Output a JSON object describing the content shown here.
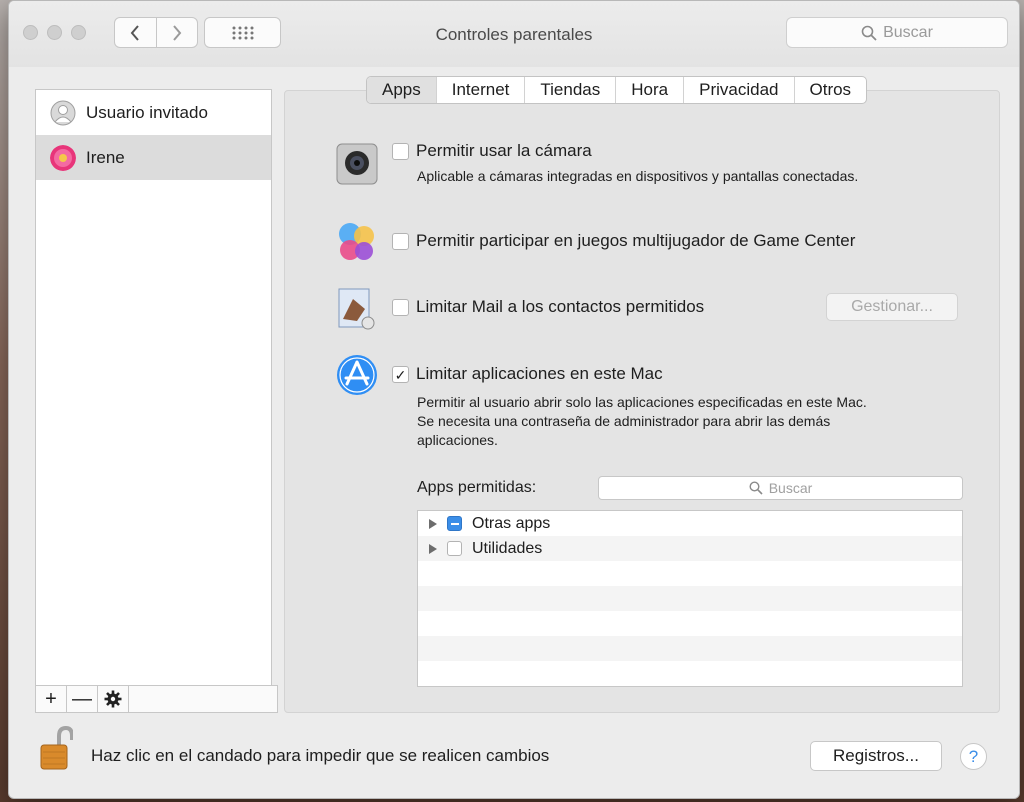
{
  "window": {
    "title": "Controles parentales"
  },
  "toolbar": {
    "search_placeholder": "Buscar"
  },
  "sidebar": {
    "users": [
      {
        "name": "Usuario invitado",
        "avatar": "guest-avatar-icon"
      },
      {
        "name": "Irene",
        "avatar": "flower-avatar-icon",
        "selected": true
      }
    ],
    "tools": [
      "+",
      "—",
      "gear-icon"
    ]
  },
  "tabs": [
    {
      "label": "Apps",
      "active": true
    },
    {
      "label": "Internet"
    },
    {
      "label": "Tiendas"
    },
    {
      "label": "Hora"
    },
    {
      "label": "Privacidad"
    },
    {
      "label": "Otros"
    }
  ],
  "options": {
    "camera": {
      "label": "Permitir usar la cámara",
      "desc": "Aplicable a cámaras integradas en dispositivos y pantallas conectadas.",
      "checked": false
    },
    "gamecenter": {
      "label": "Permitir participar en juegos multijugador de Game Center",
      "checked": false
    },
    "mail": {
      "label": "Limitar Mail a los contactos permitidos",
      "checked": false,
      "manage_button": "Gestionar..."
    },
    "apps": {
      "label": "Limitar aplicaciones en este Mac",
      "checked": true,
      "desc1": "Permitir al usuario abrir solo las aplicaciones especificadas en este Mac.",
      "desc2": "Se necesita una contraseña de administrador para abrir las demás",
      "desc3": "aplicaciones."
    }
  },
  "allowed_apps": {
    "label": "Apps permitidas:",
    "search_placeholder": "Buscar",
    "items": [
      {
        "name": "Otras apps",
        "state": "mixed"
      },
      {
        "name": "Utilidades",
        "state": "unchecked"
      }
    ]
  },
  "footer": {
    "lock_text": "Haz clic en el candado para impedir que se realicen cambios",
    "logs_button": "Registros...",
    "help": "?"
  }
}
